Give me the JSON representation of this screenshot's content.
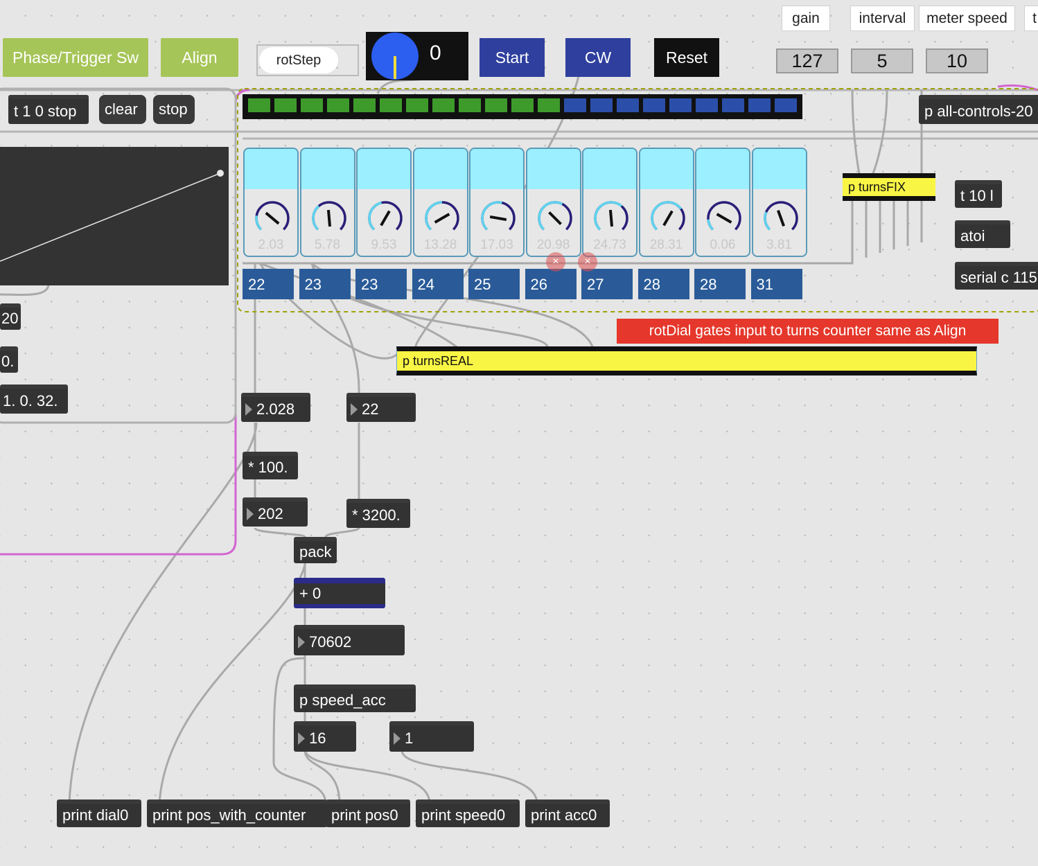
{
  "buttons": {
    "phase_trigger": "Phase/Trigger Sw",
    "align": "Align",
    "start": "Start",
    "cw": "CW",
    "reset": "Reset"
  },
  "toggle": {
    "rotstep": "rotStep"
  },
  "dial_display": {
    "value": "0"
  },
  "comments": {
    "gain": "gain",
    "interval": "interval",
    "meter_speed": "meter speed",
    "t_cut": "t"
  },
  "number_boxes": {
    "gain": "127",
    "interval": "5",
    "meter_speed": "10"
  },
  "messages": {
    "t_stop": "t 1 0 stop",
    "clear": "clear",
    "stop": "stop"
  },
  "left_fragments": [
    "20",
    "0.",
    "1. 0. 32."
  ],
  "meter": {
    "green_segments": 12,
    "total_segments": 21,
    "colors": {
      "green": "#3e9b2b",
      "blue": "#2b4fa8"
    }
  },
  "dials": [
    {
      "value": "2.03"
    },
    {
      "value": "5.78"
    },
    {
      "value": "9.53"
    },
    {
      "value": "13.28"
    },
    {
      "value": "17.03"
    },
    {
      "value": "20.98"
    },
    {
      "value": "24.73"
    },
    {
      "value": "28.31"
    },
    {
      "value": "0.06"
    },
    {
      "value": "3.81"
    }
  ],
  "tiles": [
    "22",
    "23",
    "23",
    "24",
    "25",
    "26",
    "27",
    "28",
    "28",
    "31"
  ],
  "subpatchers": {
    "turns_fix": "p turnsFIX",
    "turns_real": "p turnsREAL",
    "all_controls": "p all-controls-20",
    "speed_acc": "p speed_acc"
  },
  "right_objects": {
    "t10": "t 10 l",
    "atoi": "atoi",
    "serial": "serial c 115"
  },
  "annotation": "rotDial gates input to turns counter same as Align",
  "chain": {
    "n2028": "2.028",
    "n22": "22",
    "mul100": "* 100.",
    "n202": "202",
    "mul3200": "* 3200.",
    "pack": "pack",
    "plus0": "+ 0",
    "n70602": "70602",
    "n16": "16",
    "n1": "1"
  },
  "prints": {
    "dial0": "print dial0",
    "pos_counter": "print pos_with_counter",
    "pos0": "print pos0",
    "speed0": "print speed0",
    "acc0": "print acc0"
  }
}
